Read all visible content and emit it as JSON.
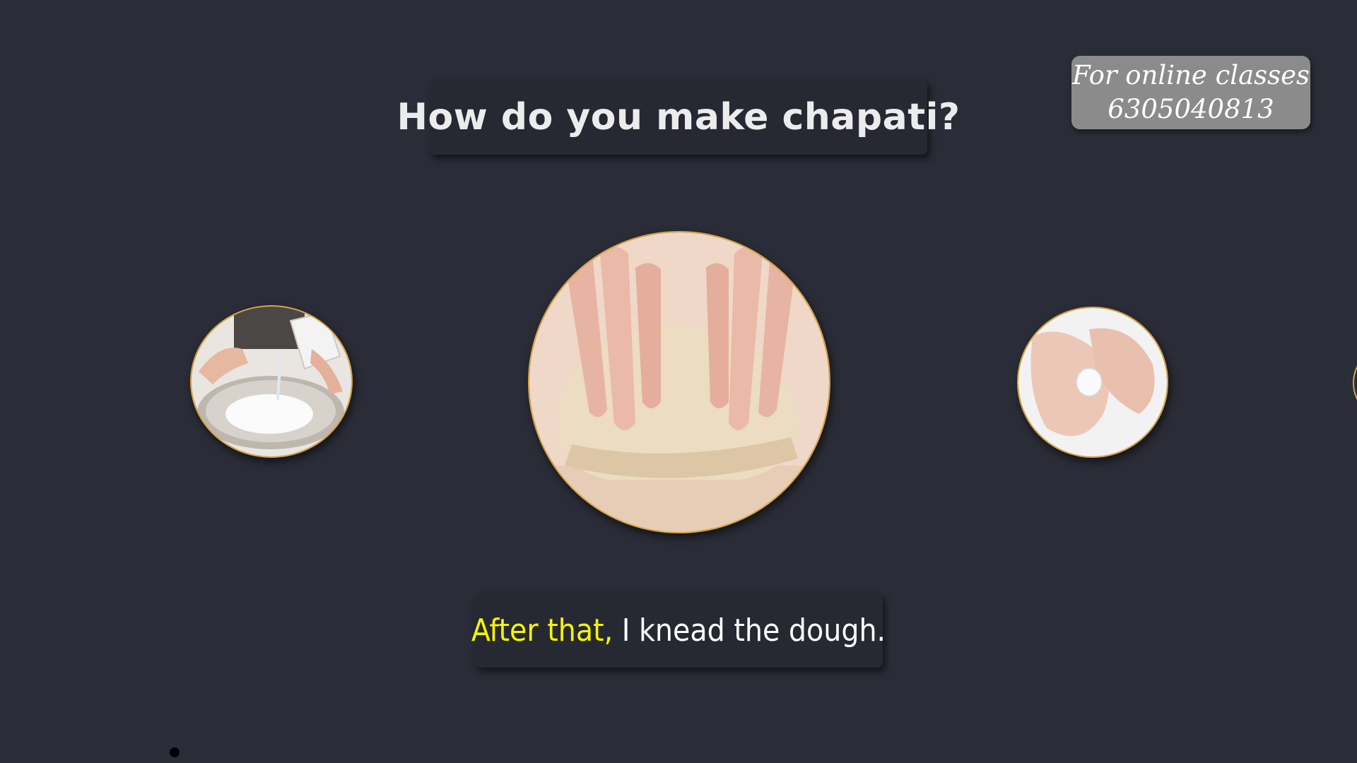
{
  "title": "How do you make chapati?",
  "promo": {
    "line1": "For online classes",
    "line2": "6305040813"
  },
  "caption": {
    "highlight": "After that,",
    "rest": " I knead the dough."
  },
  "images": {
    "left": "pouring-water-into-flour-bowl",
    "center": "hands-kneading-dough",
    "right": "dough-ball-in-palms"
  },
  "colors": {
    "background": "#2a2d37",
    "box": "#262932",
    "highlight": "#f5f500",
    "ring": "#d9a441",
    "promo": "#8b8b8b"
  }
}
